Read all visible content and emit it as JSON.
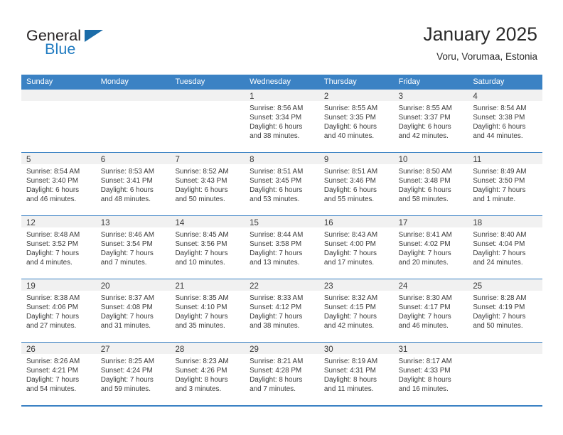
{
  "brand": {
    "name_part1": "General",
    "name_part2": "Blue"
  },
  "header": {
    "title": "January 2025",
    "subtitle": "Voru, Vorumaa, Estonia"
  },
  "calendar": {
    "day_headers": [
      "Sunday",
      "Monday",
      "Tuesday",
      "Wednesday",
      "Thursday",
      "Friday",
      "Saturday"
    ],
    "accent_color": "#3b82c4",
    "band_color": "#f1f1f1",
    "weeks": [
      [
        {
          "day": "",
          "sunrise": "",
          "sunset": "",
          "daylight_line1": "",
          "daylight_line2": ""
        },
        {
          "day": "",
          "sunrise": "",
          "sunset": "",
          "daylight_line1": "",
          "daylight_line2": ""
        },
        {
          "day": "",
          "sunrise": "",
          "sunset": "",
          "daylight_line1": "",
          "daylight_line2": ""
        },
        {
          "day": "1",
          "sunrise": "Sunrise: 8:56 AM",
          "sunset": "Sunset: 3:34 PM",
          "daylight_line1": "Daylight: 6 hours",
          "daylight_line2": "and 38 minutes."
        },
        {
          "day": "2",
          "sunrise": "Sunrise: 8:55 AM",
          "sunset": "Sunset: 3:35 PM",
          "daylight_line1": "Daylight: 6 hours",
          "daylight_line2": "and 40 minutes."
        },
        {
          "day": "3",
          "sunrise": "Sunrise: 8:55 AM",
          "sunset": "Sunset: 3:37 PM",
          "daylight_line1": "Daylight: 6 hours",
          "daylight_line2": "and 42 minutes."
        },
        {
          "day": "4",
          "sunrise": "Sunrise: 8:54 AM",
          "sunset": "Sunset: 3:38 PM",
          "daylight_line1": "Daylight: 6 hours",
          "daylight_line2": "and 44 minutes."
        }
      ],
      [
        {
          "day": "5",
          "sunrise": "Sunrise: 8:54 AM",
          "sunset": "Sunset: 3:40 PM",
          "daylight_line1": "Daylight: 6 hours",
          "daylight_line2": "and 46 minutes."
        },
        {
          "day": "6",
          "sunrise": "Sunrise: 8:53 AM",
          "sunset": "Sunset: 3:41 PM",
          "daylight_line1": "Daylight: 6 hours",
          "daylight_line2": "and 48 minutes."
        },
        {
          "day": "7",
          "sunrise": "Sunrise: 8:52 AM",
          "sunset": "Sunset: 3:43 PM",
          "daylight_line1": "Daylight: 6 hours",
          "daylight_line2": "and 50 minutes."
        },
        {
          "day": "8",
          "sunrise": "Sunrise: 8:51 AM",
          "sunset": "Sunset: 3:45 PM",
          "daylight_line1": "Daylight: 6 hours",
          "daylight_line2": "and 53 minutes."
        },
        {
          "day": "9",
          "sunrise": "Sunrise: 8:51 AM",
          "sunset": "Sunset: 3:46 PM",
          "daylight_line1": "Daylight: 6 hours",
          "daylight_line2": "and 55 minutes."
        },
        {
          "day": "10",
          "sunrise": "Sunrise: 8:50 AM",
          "sunset": "Sunset: 3:48 PM",
          "daylight_line1": "Daylight: 6 hours",
          "daylight_line2": "and 58 minutes."
        },
        {
          "day": "11",
          "sunrise": "Sunrise: 8:49 AM",
          "sunset": "Sunset: 3:50 PM",
          "daylight_line1": "Daylight: 7 hours",
          "daylight_line2": "and 1 minute."
        }
      ],
      [
        {
          "day": "12",
          "sunrise": "Sunrise: 8:48 AM",
          "sunset": "Sunset: 3:52 PM",
          "daylight_line1": "Daylight: 7 hours",
          "daylight_line2": "and 4 minutes."
        },
        {
          "day": "13",
          "sunrise": "Sunrise: 8:46 AM",
          "sunset": "Sunset: 3:54 PM",
          "daylight_line1": "Daylight: 7 hours",
          "daylight_line2": "and 7 minutes."
        },
        {
          "day": "14",
          "sunrise": "Sunrise: 8:45 AM",
          "sunset": "Sunset: 3:56 PM",
          "daylight_line1": "Daylight: 7 hours",
          "daylight_line2": "and 10 minutes."
        },
        {
          "day": "15",
          "sunrise": "Sunrise: 8:44 AM",
          "sunset": "Sunset: 3:58 PM",
          "daylight_line1": "Daylight: 7 hours",
          "daylight_line2": "and 13 minutes."
        },
        {
          "day": "16",
          "sunrise": "Sunrise: 8:43 AM",
          "sunset": "Sunset: 4:00 PM",
          "daylight_line1": "Daylight: 7 hours",
          "daylight_line2": "and 17 minutes."
        },
        {
          "day": "17",
          "sunrise": "Sunrise: 8:41 AM",
          "sunset": "Sunset: 4:02 PM",
          "daylight_line1": "Daylight: 7 hours",
          "daylight_line2": "and 20 minutes."
        },
        {
          "day": "18",
          "sunrise": "Sunrise: 8:40 AM",
          "sunset": "Sunset: 4:04 PM",
          "daylight_line1": "Daylight: 7 hours",
          "daylight_line2": "and 24 minutes."
        }
      ],
      [
        {
          "day": "19",
          "sunrise": "Sunrise: 8:38 AM",
          "sunset": "Sunset: 4:06 PM",
          "daylight_line1": "Daylight: 7 hours",
          "daylight_line2": "and 27 minutes."
        },
        {
          "day": "20",
          "sunrise": "Sunrise: 8:37 AM",
          "sunset": "Sunset: 4:08 PM",
          "daylight_line1": "Daylight: 7 hours",
          "daylight_line2": "and 31 minutes."
        },
        {
          "day": "21",
          "sunrise": "Sunrise: 8:35 AM",
          "sunset": "Sunset: 4:10 PM",
          "daylight_line1": "Daylight: 7 hours",
          "daylight_line2": "and 35 minutes."
        },
        {
          "day": "22",
          "sunrise": "Sunrise: 8:33 AM",
          "sunset": "Sunset: 4:12 PM",
          "daylight_line1": "Daylight: 7 hours",
          "daylight_line2": "and 38 minutes."
        },
        {
          "day": "23",
          "sunrise": "Sunrise: 8:32 AM",
          "sunset": "Sunset: 4:15 PM",
          "daylight_line1": "Daylight: 7 hours",
          "daylight_line2": "and 42 minutes."
        },
        {
          "day": "24",
          "sunrise": "Sunrise: 8:30 AM",
          "sunset": "Sunset: 4:17 PM",
          "daylight_line1": "Daylight: 7 hours",
          "daylight_line2": "and 46 minutes."
        },
        {
          "day": "25",
          "sunrise": "Sunrise: 8:28 AM",
          "sunset": "Sunset: 4:19 PM",
          "daylight_line1": "Daylight: 7 hours",
          "daylight_line2": "and 50 minutes."
        }
      ],
      [
        {
          "day": "26",
          "sunrise": "Sunrise: 8:26 AM",
          "sunset": "Sunset: 4:21 PM",
          "daylight_line1": "Daylight: 7 hours",
          "daylight_line2": "and 54 minutes."
        },
        {
          "day": "27",
          "sunrise": "Sunrise: 8:25 AM",
          "sunset": "Sunset: 4:24 PM",
          "daylight_line1": "Daylight: 7 hours",
          "daylight_line2": "and 59 minutes."
        },
        {
          "day": "28",
          "sunrise": "Sunrise: 8:23 AM",
          "sunset": "Sunset: 4:26 PM",
          "daylight_line1": "Daylight: 8 hours",
          "daylight_line2": "and 3 minutes."
        },
        {
          "day": "29",
          "sunrise": "Sunrise: 8:21 AM",
          "sunset": "Sunset: 4:28 PM",
          "daylight_line1": "Daylight: 8 hours",
          "daylight_line2": "and 7 minutes."
        },
        {
          "day": "30",
          "sunrise": "Sunrise: 8:19 AM",
          "sunset": "Sunset: 4:31 PM",
          "daylight_line1": "Daylight: 8 hours",
          "daylight_line2": "and 11 minutes."
        },
        {
          "day": "31",
          "sunrise": "Sunrise: 8:17 AM",
          "sunset": "Sunset: 4:33 PM",
          "daylight_line1": "Daylight: 8 hours",
          "daylight_line2": "and 16 minutes."
        },
        {
          "day": "",
          "sunrise": "",
          "sunset": "",
          "daylight_line1": "",
          "daylight_line2": ""
        }
      ]
    ]
  }
}
